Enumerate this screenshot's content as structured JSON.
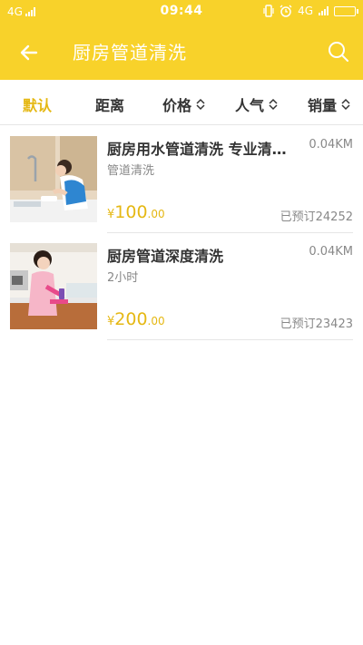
{
  "status": {
    "network": "4G",
    "time": "09:44",
    "network2": "4G"
  },
  "header": {
    "title": "厨房管道清洗"
  },
  "sort": {
    "items": [
      {
        "label": "默认",
        "active": true
      },
      {
        "label": "距离"
      },
      {
        "label": "价格"
      },
      {
        "label": "人气"
      },
      {
        "label": "销量"
      }
    ]
  },
  "services": [
    {
      "title": "厨房用水管道清洗 专业清洁...",
      "distance": "0.04KM",
      "subtitle": "管道清洗",
      "currency": "¥",
      "price_int": "100",
      "price_dec": ".00",
      "booked": "已预订24252"
    },
    {
      "title": "厨房管道深度清洗",
      "distance": "0.04KM",
      "subtitle": "2小时",
      "currency": "¥",
      "price_int": "200",
      "price_dec": ".00",
      "booked": "已预订23423"
    }
  ],
  "colors": {
    "brand": "#f8d22a",
    "accent": "#e5b814"
  }
}
